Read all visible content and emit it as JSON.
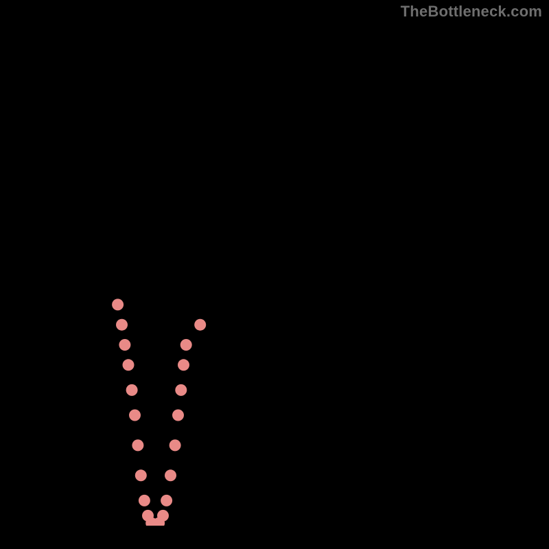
{
  "watermark": "TheBottleneck.com",
  "chart_data": {
    "type": "line",
    "title": "",
    "xlabel": "",
    "ylabel": "",
    "xlim": [
      0,
      100
    ],
    "ylim": [
      0,
      100
    ],
    "grid": false,
    "background_gradient": [
      "#ff1552",
      "#ffd22e",
      "#00e5cd"
    ],
    "series": [
      {
        "name": "bottleneck-curve",
        "color": "#000000",
        "x": [
          6,
          8,
          10,
          12,
          14,
          16,
          18,
          20,
          22,
          23.5,
          25,
          27,
          29,
          31,
          32.5,
          36,
          40,
          45,
          50,
          55,
          60,
          65,
          70,
          75,
          80,
          85,
          90,
          95,
          100
        ],
        "y": [
          100,
          93,
          85,
          77,
          69,
          60,
          51,
          40,
          25,
          10,
          1,
          0,
          2,
          12,
          26,
          39,
          48,
          56,
          63,
          69,
          74,
          78,
          81,
          84,
          86.5,
          88.5,
          90,
          91.5,
          92.5
        ]
      }
    ],
    "markers": {
      "name": "data-points",
      "color": "#e98a87",
      "points_x": [
        18.8,
        19.6,
        20.2,
        20.9,
        21.6,
        22.2,
        22.8,
        23.4,
        24.1,
        24.8,
        25.5,
        26.2,
        27.0,
        27.8,
        28.5,
        29.3,
        30.2,
        30.8,
        31.4,
        31.9,
        32.4,
        35.2
      ],
      "points_y": [
        44,
        40,
        36,
        32,
        27,
        22,
        16,
        10,
        5,
        2,
        0.5,
        0,
        0.5,
        2,
        5,
        10,
        16,
        22,
        27,
        32,
        36,
        40
      ]
    }
  }
}
